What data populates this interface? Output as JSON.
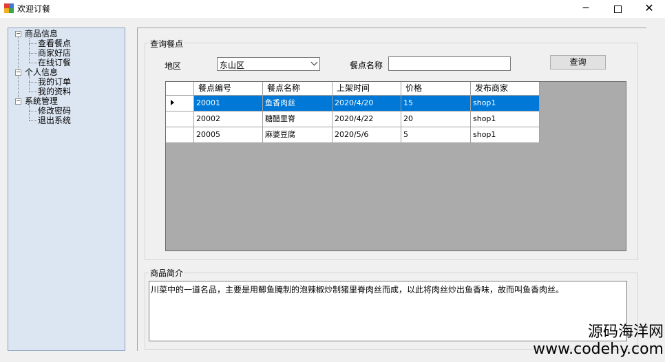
{
  "window": {
    "title": "欢迎订餐",
    "min_glyph": "─",
    "close_glyph": "✕"
  },
  "tree": {
    "groups": [
      {
        "label": "商品信息",
        "expander": "−",
        "children": [
          "查看餐点",
          "商家好店",
          "在线订餐"
        ]
      },
      {
        "label": "个人信息",
        "expander": "−",
        "children": [
          "我的订单",
          "我的资料"
        ]
      },
      {
        "label": "系统管理",
        "expander": "−",
        "children": [
          "修改密码",
          "退出系统"
        ]
      }
    ]
  },
  "query": {
    "group_title": "查询餐点",
    "region_label": "地区",
    "region_value": "东山区",
    "name_label": "餐点名称",
    "name_value": "",
    "search_button": "查询"
  },
  "table": {
    "columns": [
      "餐点编号",
      "餐点名称",
      "上架时间",
      "价格",
      "发布商家"
    ],
    "rows": [
      [
        "20001",
        "鱼香肉丝",
        "2020/4/20",
        "15",
        "shop1"
      ],
      [
        "20002",
        "糖醋里脊",
        "2020/4/22",
        "20",
        "shop1"
      ],
      [
        "20005",
        "麻婆豆腐",
        "2020/5/6",
        "5",
        "shop1"
      ]
    ],
    "selected_row": 0
  },
  "intro": {
    "group_title": "商品简介",
    "text": "川菜中的一道名品，主要是用鲫鱼腌制的泡辣椒炒制猪里脊肉丝而成，以此将肉丝炒出鱼香味，故而叫鱼香肉丝。"
  },
  "watermark": {
    "line1": "源码海洋网",
    "line2": "www.codehy.com"
  }
}
